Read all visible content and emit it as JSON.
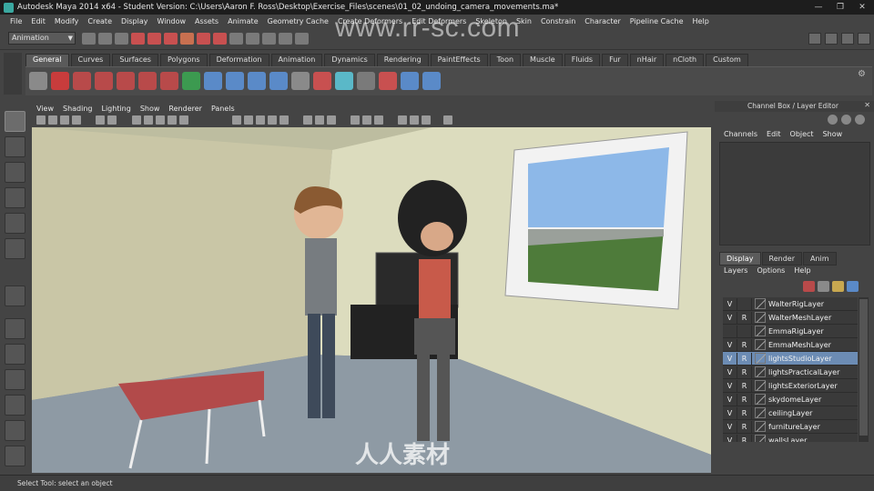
{
  "window": {
    "title": "Autodesk Maya 2014 x64 - Student Version: C:\\Users\\Aaron F. Ross\\Desktop\\Exercise_Files\\scenes\\01_02_undoing_camera_movements.ma*",
    "controls": [
      "minimize",
      "restore",
      "close"
    ]
  },
  "menubar": [
    "File",
    "Edit",
    "Modify",
    "Create",
    "Display",
    "Window",
    "Assets",
    "Animate",
    "Geometry Cache",
    "Create Deformers",
    "Edit Deformers",
    "Skeleton",
    "Skin",
    "Constrain",
    "Character",
    "Pipeline Cache",
    "Help"
  ],
  "statusline": {
    "mode": "Animation"
  },
  "shelf": {
    "tabs": [
      "General",
      "Curves",
      "Surfaces",
      "Polygons",
      "Deformation",
      "Animation",
      "Dynamics",
      "Rendering",
      "PaintEffects",
      "Toon",
      "Muscle",
      "Fluids",
      "Fur",
      "nHair",
      "nCloth",
      "Custom"
    ],
    "active_tab": "General"
  },
  "panel": {
    "menu": [
      "View",
      "Shading",
      "Lighting",
      "Show",
      "Renderer",
      "Panels"
    ]
  },
  "watermark": {
    "url": "www.rr-sc.com",
    "logo_text": "人人素材"
  },
  "channel_box": {
    "title": "Channel Box / Layer Editor",
    "menu": [
      "Channels",
      "Edit",
      "Object",
      "Show"
    ]
  },
  "layer_editor": {
    "tabs": [
      "Display",
      "Render",
      "Anim"
    ],
    "active_tab": "Display",
    "menu": [
      "Layers",
      "Options",
      "Help"
    ],
    "layers": [
      {
        "v": "V",
        "r": "",
        "name": "WalterRigLayer",
        "selected": false
      },
      {
        "v": "V",
        "r": "R",
        "name": "WalterMeshLayer",
        "selected": false
      },
      {
        "v": "",
        "r": "",
        "name": "EmmaRigLayer",
        "selected": false
      },
      {
        "v": "V",
        "r": "R",
        "name": "EmmaMeshLayer",
        "selected": false
      },
      {
        "v": "V",
        "r": "R",
        "name": "lightsStudioLayer",
        "selected": true
      },
      {
        "v": "V",
        "r": "R",
        "name": "lightsPracticalLayer",
        "selected": false
      },
      {
        "v": "V",
        "r": "R",
        "name": "lightsExteriorLayer",
        "selected": false
      },
      {
        "v": "V",
        "r": "R",
        "name": "skydomeLayer",
        "selected": false
      },
      {
        "v": "V",
        "r": "R",
        "name": "ceilingLayer",
        "selected": false
      },
      {
        "v": "V",
        "r": "R",
        "name": "furnitureLayer",
        "selected": false
      },
      {
        "v": "V",
        "r": "R",
        "name": "wallsLayer",
        "selected": false
      }
    ]
  },
  "helpline": {
    "text": "Select Tool: select an object"
  }
}
